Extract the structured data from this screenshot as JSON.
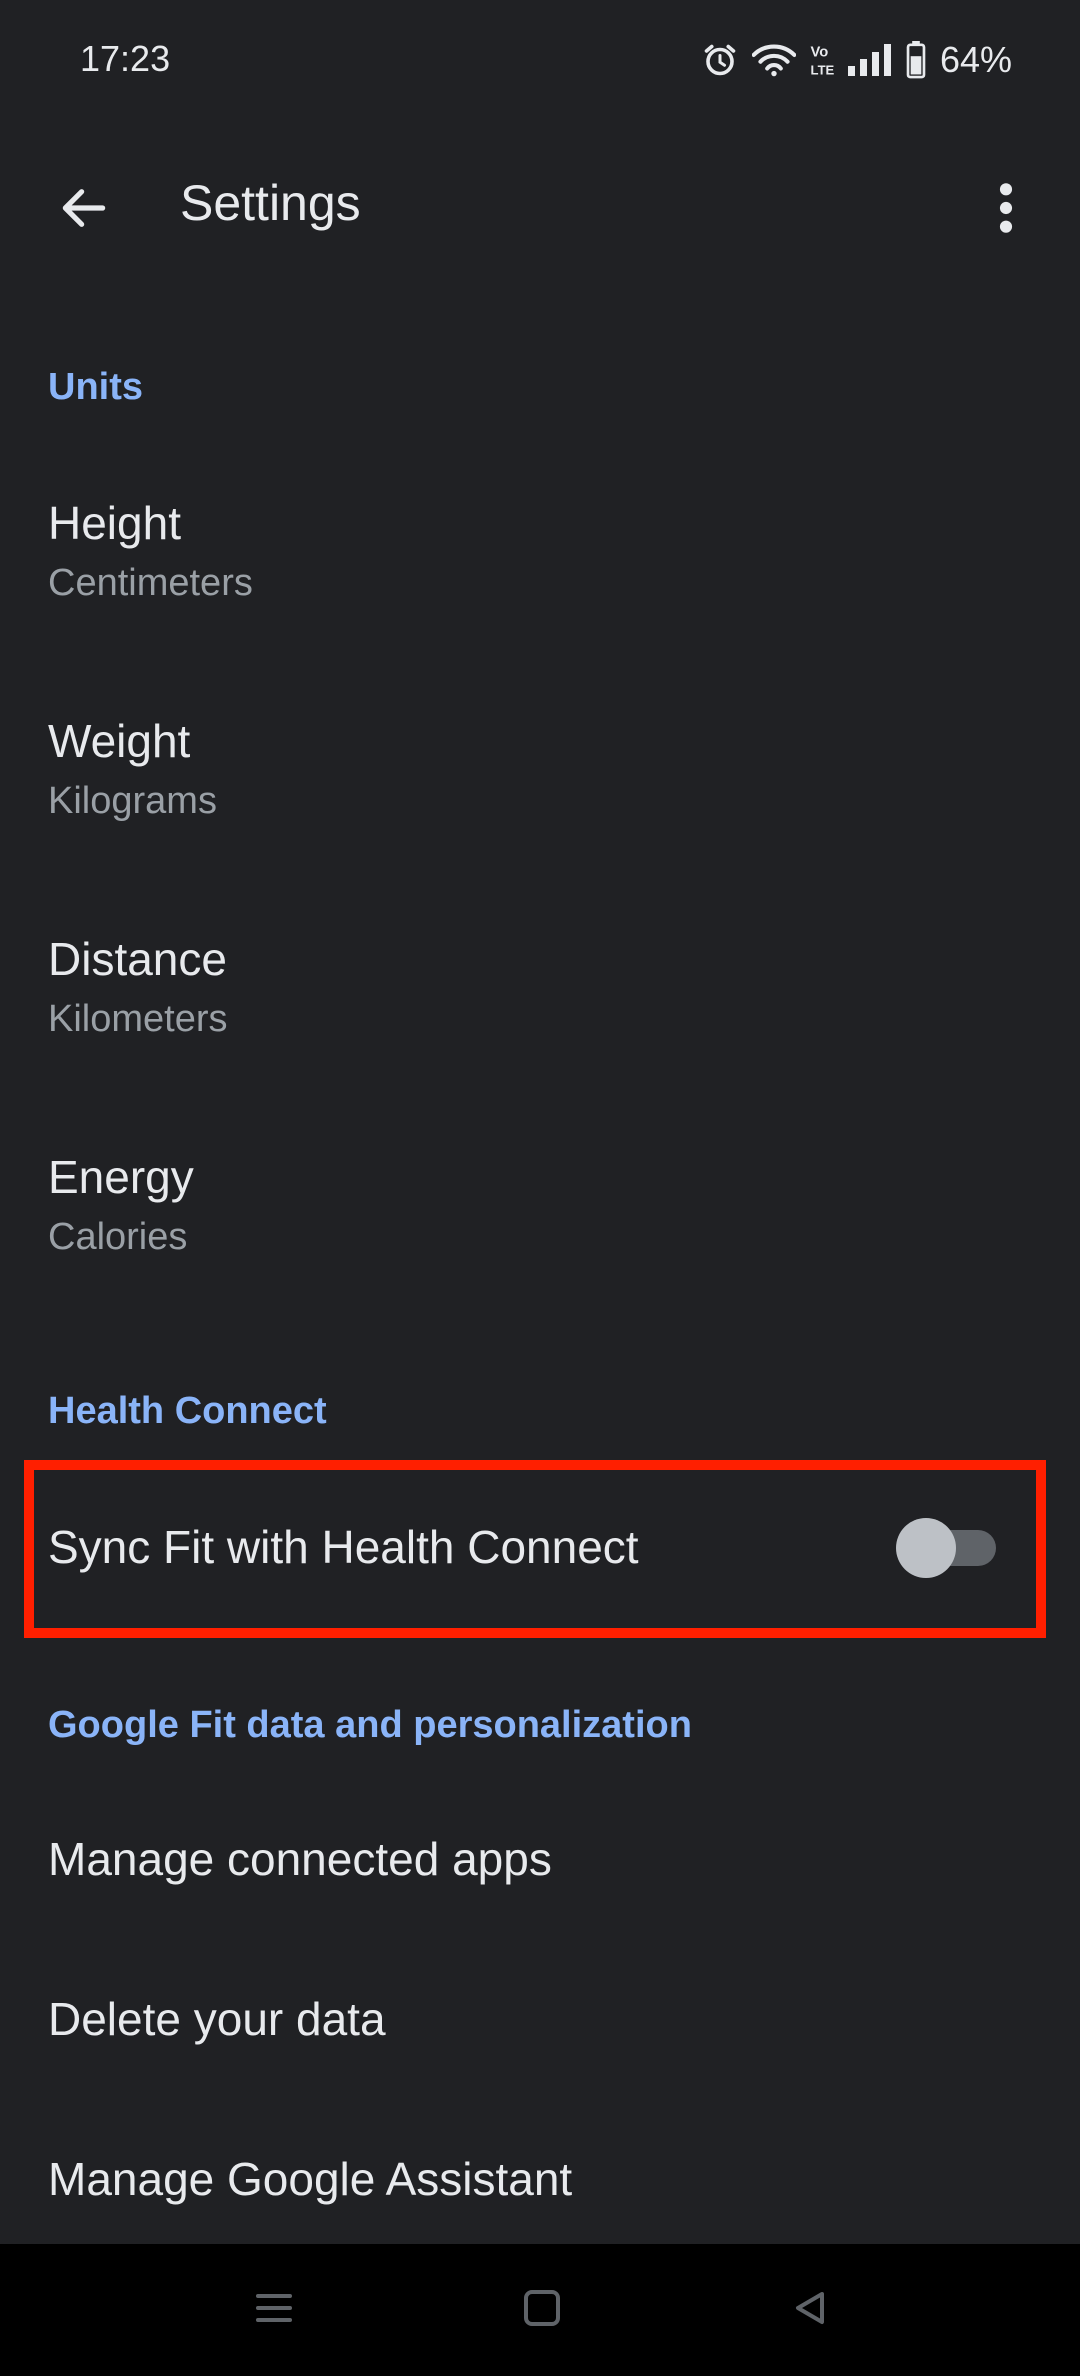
{
  "status_bar": {
    "time": "17:23",
    "battery_percent": "64%",
    "icons": [
      "alarm-icon",
      "wifi-icon",
      "volte-icon",
      "signal-icon",
      "battery-icon"
    ]
  },
  "app_bar": {
    "title": "Settings",
    "back_icon": "arrow-back-icon",
    "menu_icon": "more-vert-icon"
  },
  "sections": {
    "units": {
      "header": "Units",
      "items": [
        {
          "title": "Height",
          "value": "Centimeters"
        },
        {
          "title": "Weight",
          "value": "Kilograms"
        },
        {
          "title": "Distance",
          "value": "Kilometers"
        },
        {
          "title": "Energy",
          "value": "Calories"
        }
      ]
    },
    "health_connect": {
      "header": "Health Connect",
      "sync_label": "Sync Fit with Health Connect",
      "sync_enabled": false
    },
    "data": {
      "header": "Google Fit data and personalization",
      "items": [
        {
          "title": "Manage connected apps"
        },
        {
          "title": "Delete your data"
        },
        {
          "title": "Manage Google Assistant"
        }
      ]
    }
  },
  "colors": {
    "background": "#202124",
    "accent": "#8ab4f8",
    "highlight": "#ff1f00",
    "nav_bar": "#000000"
  },
  "nav_bar": {
    "icons": [
      "recents-icon",
      "home-icon",
      "back-triangle-icon"
    ]
  }
}
